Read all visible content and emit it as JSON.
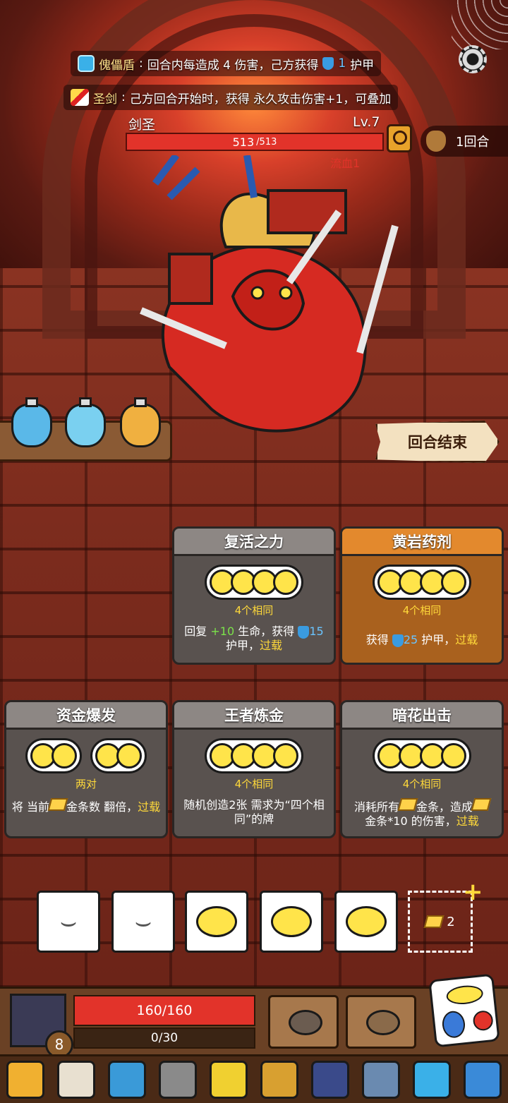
{
  "buffs": [
    {
      "name": "傀儡盾",
      "colon": ":",
      "text_before": "回合内每造成 4 伤害，己方获得",
      "shield_value": "1",
      "text_after": "护甲"
    },
    {
      "name": "圣剑",
      "colon": ":",
      "text": "己方回合开始时，获得 永久攻击伤害+1，可叠加"
    }
  ],
  "enemy": {
    "name": "剑圣",
    "level": "Lv.7",
    "hp": "513",
    "hp_max": "/513",
    "status": "流血1"
  },
  "turn_counter": "1回合",
  "end_turn": "回合结束",
  "cards": [
    {
      "title": "复活之力",
      "requirement": "4个相同",
      "desc_a": "回复 ",
      "heal": "+10",
      "desc_b": " 生命，获得 ",
      "armor": "15",
      "desc_c": " 护甲，",
      "overload": "过载"
    },
    {
      "title": "黄岩药剂",
      "requirement": "4个相同",
      "desc_a": "获得 ",
      "armor": "25",
      "desc_b": " 护甲，",
      "overload": "过载"
    },
    {
      "title": "资金爆发",
      "requirement": "两对",
      "desc_a": "将 当前",
      "desc_b": "金条数 翻倍，",
      "overload": "过载"
    },
    {
      "title": "王者炼金",
      "requirement": "4个相同",
      "desc": "随机创造2张 需求为“四个相同”的牌"
    },
    {
      "title": "暗花出击",
      "requirement": "4个相同",
      "desc_a": "消耗所有",
      "desc_b": "金条，造成",
      "desc_c": "金条*10 的伤害，",
      "overload": "过载"
    }
  ],
  "gold_slot": "2",
  "player": {
    "level": "8",
    "hp": "160/160",
    "xp": "0/30"
  },
  "colors": {
    "hp_red": "#e2332a",
    "gold_text": "#ffd93a",
    "card_orange": "#e3892d",
    "card_gray": "#59524f"
  }
}
